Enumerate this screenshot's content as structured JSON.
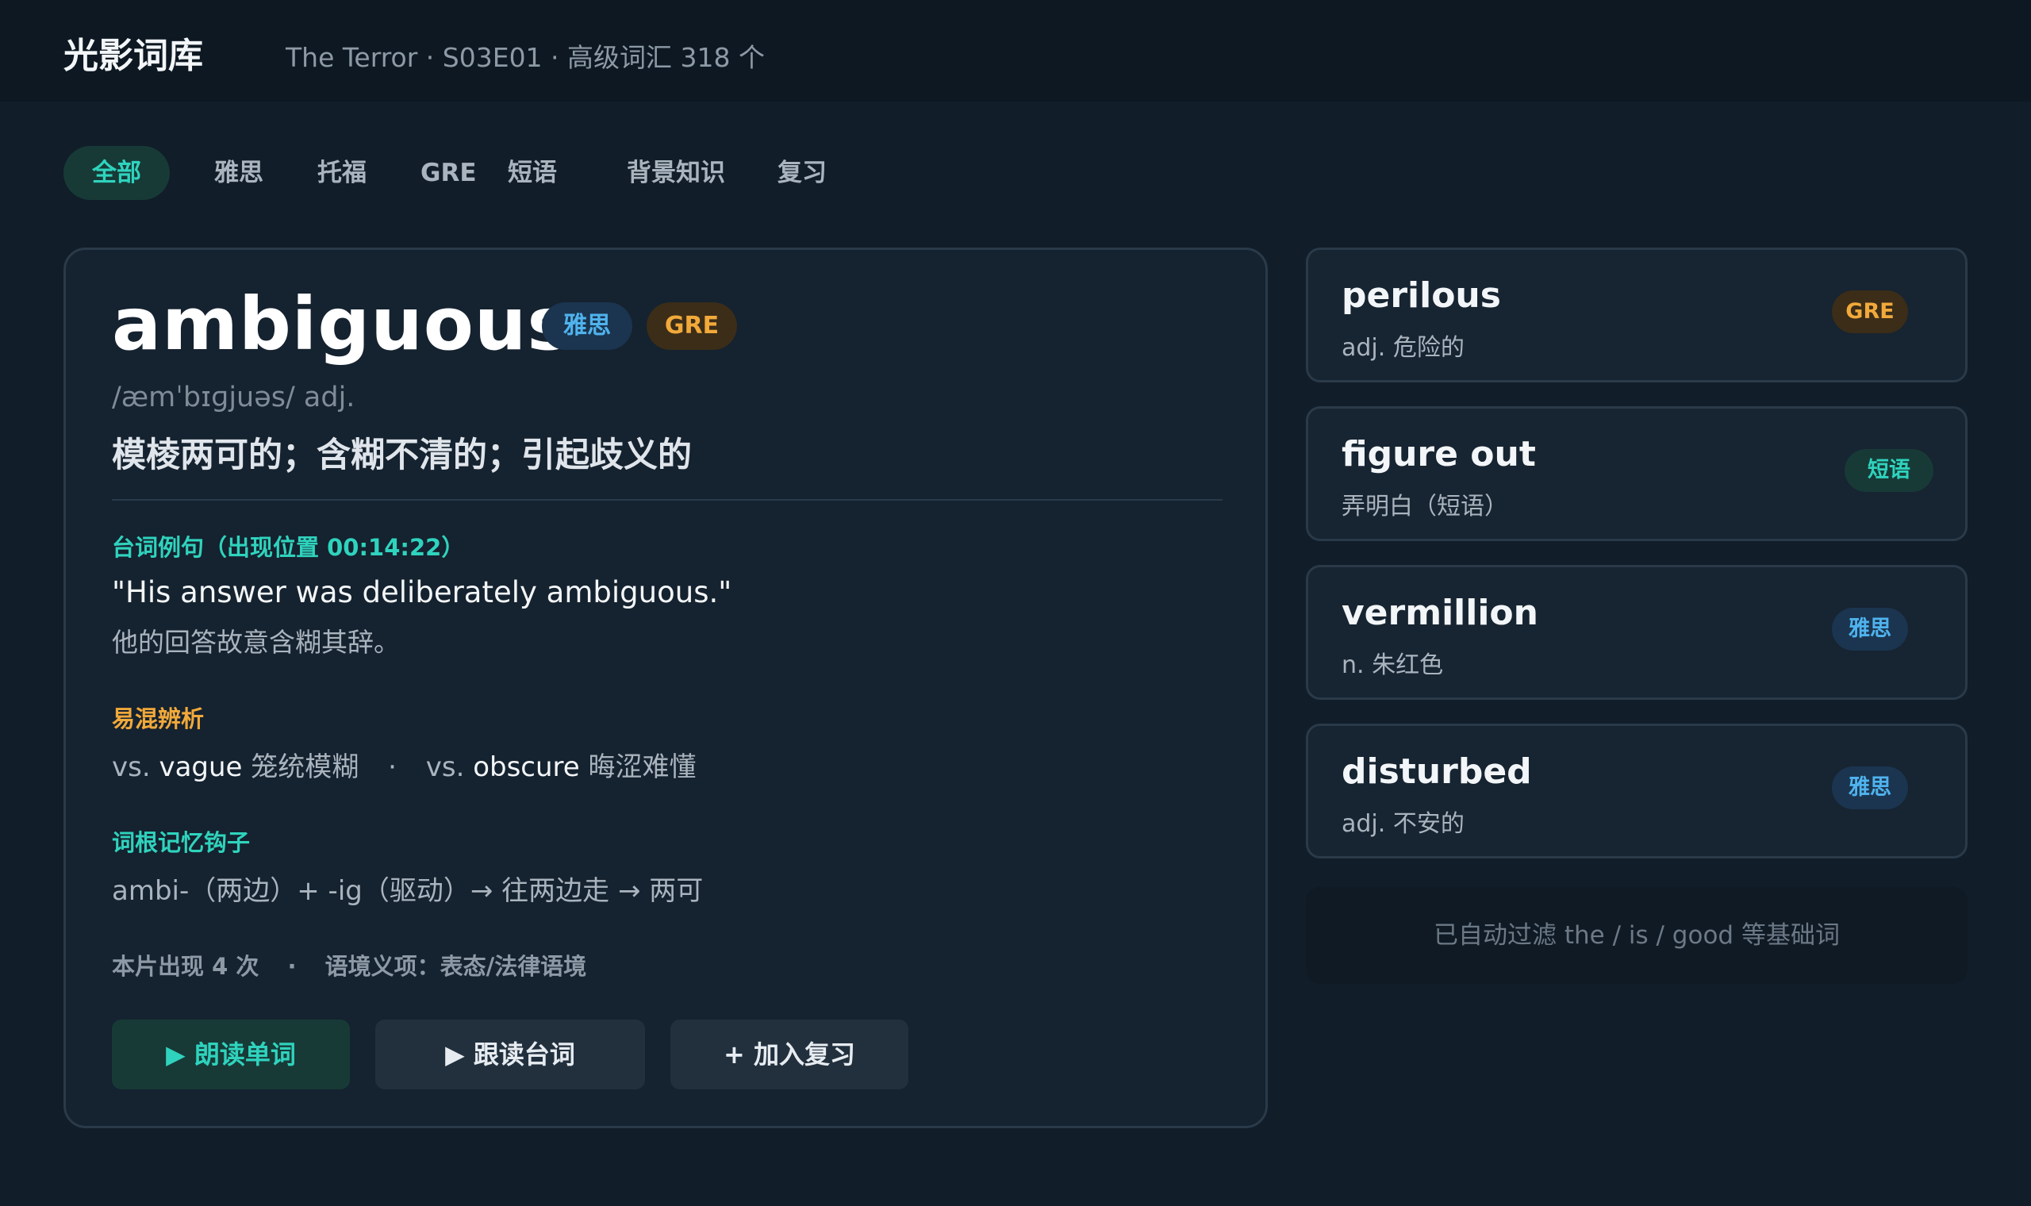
{
  "header": {
    "app_title": "光影词库",
    "subtitle": "The Terror · S03E01 · 高级词汇 318 个"
  },
  "tabs": [
    {
      "label": "全部",
      "active": true
    },
    {
      "label": "雅思",
      "active": false
    },
    {
      "label": "托福",
      "active": false
    },
    {
      "label": "GRE",
      "active": false
    },
    {
      "label": "短语",
      "active": false
    },
    {
      "label": "背景知识",
      "active": false
    },
    {
      "label": "复习",
      "active": false
    }
  ],
  "main_word": {
    "word": "ambiguous",
    "tags": [
      "雅思",
      "GRE"
    ],
    "phonetic": "/æmˈbɪɡjuəs/ adj.",
    "meaning": "模棱两可的；含糊不清的；引起歧义的",
    "example_label": "台词例句（出现位置 00:14:22）",
    "example_en": "\"His answer was deliberately ambiguous.\"",
    "example_zh": "他的回答故意含糊其辞。",
    "confusion_label": "易混辨析",
    "confusion": {
      "vs1_prefix": "vs.",
      "vs1_word": "vague",
      "vs1_meaning": "笼统模糊",
      "separator": "·",
      "vs2_prefix": "vs.",
      "vs2_word": "obscure",
      "vs2_meaning": "晦涩难懂"
    },
    "root_label": "词根记忆钩子",
    "root_text": "ambi-（两边）+ -ig（驱动）→ 往两边走 → 两可",
    "meta_count": "本片出现 4 次",
    "meta_separator": "·",
    "meta_context": "语境义项：表态/法律语境",
    "buttons": {
      "play_word": "▶ 朗读单词",
      "shadow_line": "▶ 跟读台词",
      "add_review": "+ 加入复习"
    }
  },
  "side_words": [
    {
      "word": "perilous",
      "definition": "adj. 危险的",
      "tag": "GRE",
      "tag_type": "gre"
    },
    {
      "word": "figure out",
      "definition": "弄明白（短语）",
      "tag": "短语",
      "tag_type": "phrase"
    },
    {
      "word": "vermillion",
      "definition": "n. 朱红色",
      "tag": "雅思",
      "tag_type": "ielts"
    },
    {
      "word": "disturbed",
      "definition": "adj. 不安的",
      "tag": "雅思",
      "tag_type": "ielts"
    }
  ],
  "filter_note": "已自动过滤 the / is / good 等基础词",
  "colors": {
    "background": "#111d29",
    "accent_teal": "#2fd3bd",
    "accent_amber": "#f1a93a",
    "accent_blue": "#4fb3ee"
  }
}
